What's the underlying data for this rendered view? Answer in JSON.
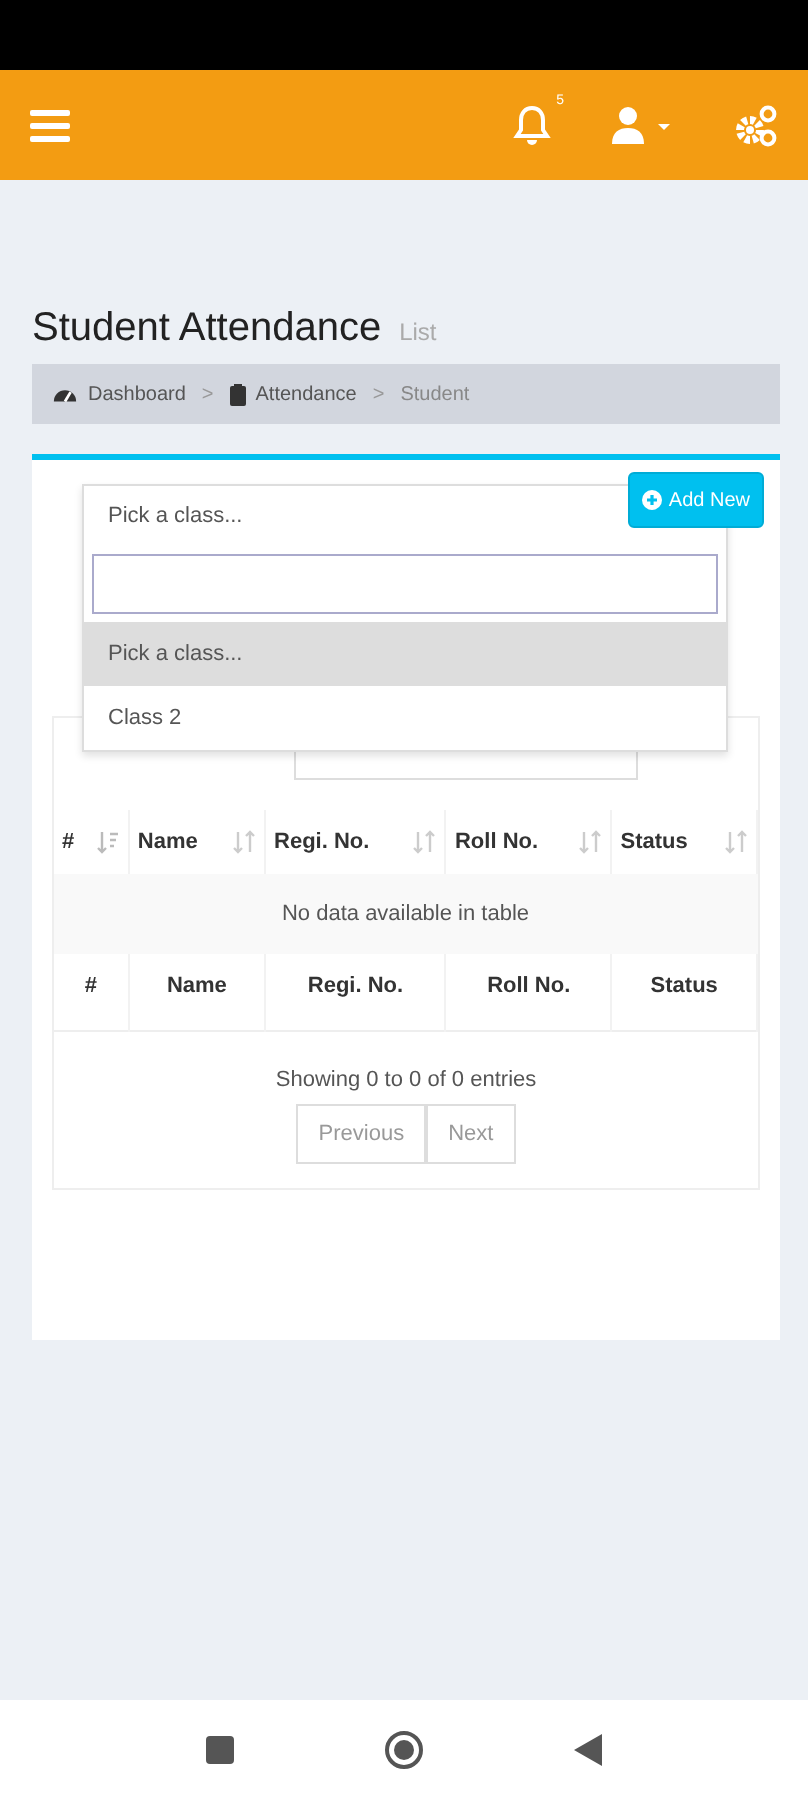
{
  "header": {
    "notification_count": "5"
  },
  "page": {
    "title": "Student Attendance",
    "subtitle": "List"
  },
  "breadcrumb": {
    "items": [
      "Dashboard",
      "Attendance",
      "Student"
    ],
    "separator": ">"
  },
  "class_select": {
    "value": "Pick a class...",
    "options": [
      {
        "label": "Pick a class...",
        "selected": true
      },
      {
        "label": "Class 2",
        "selected": false
      }
    ]
  },
  "add_button": "Add New",
  "table": {
    "columns": [
      {
        "label": "#",
        "sorted": true
      },
      {
        "label": "Name",
        "sorted": false
      },
      {
        "label": "Regi. No.",
        "sorted": false
      },
      {
        "label": "Roll No.",
        "sorted": false
      },
      {
        "label": "Status",
        "sorted": false
      }
    ],
    "empty_message": "No data available in table",
    "footer_columns": [
      "#",
      "Name",
      "Regi. No.",
      "Roll No.",
      "Status"
    ]
  },
  "info": "Showing 0 to 0 of 0 entries",
  "pagination": [
    "Previous",
    "Next"
  ]
}
